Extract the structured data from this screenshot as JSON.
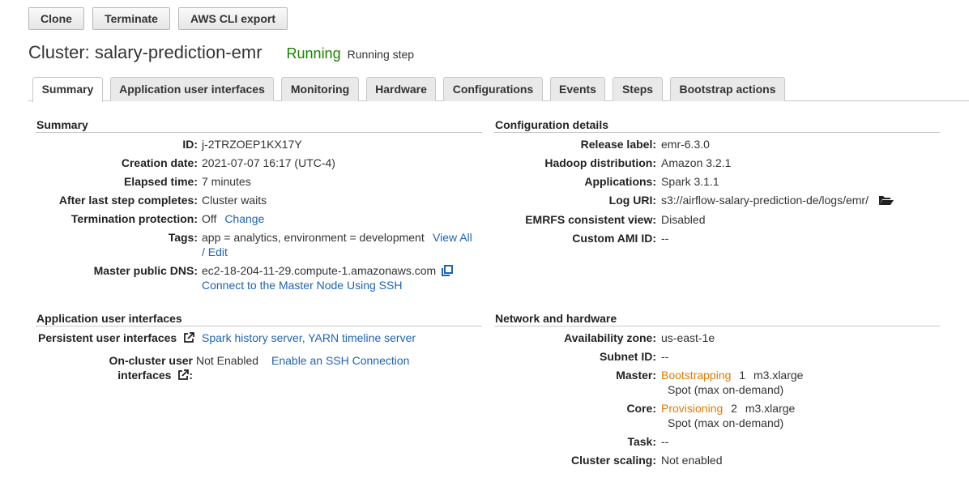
{
  "toolbar": {
    "clone_label": "Clone",
    "terminate_label": "Terminate",
    "cli_export_label": "AWS CLI export"
  },
  "header": {
    "title": "Cluster: salary-prediction-emr",
    "status": "Running",
    "status_detail": "Running step"
  },
  "tabs": [
    {
      "label": "Summary",
      "active": true
    },
    {
      "label": "Application user interfaces",
      "active": false
    },
    {
      "label": "Monitoring",
      "active": false
    },
    {
      "label": "Hardware",
      "active": false
    },
    {
      "label": "Configurations",
      "active": false
    },
    {
      "label": "Events",
      "active": false
    },
    {
      "label": "Steps",
      "active": false
    },
    {
      "label": "Bootstrap actions",
      "active": false
    }
  ],
  "summary": {
    "title": "Summary",
    "id_label": "ID:",
    "id_value": "j-2TRZOEP1KX17Y",
    "creation_label": "Creation date:",
    "creation_value": "2021-07-07 16:17 (UTC-4)",
    "elapsed_label": "Elapsed time:",
    "elapsed_value": "7 minutes",
    "after_step_label": "After last step completes:",
    "after_step_value": "Cluster waits",
    "termination_label": "Termination protection:",
    "termination_value": "Off",
    "termination_link": "Change",
    "tags_label": "Tags:",
    "tags_value": "app = analytics, environment = development",
    "tags_link_view": "View All",
    "tags_link_edit": "/ Edit",
    "dns_label": "Master public DNS:",
    "dns_value": "ec2-18-204-11-29.compute-1.amazonaws.com",
    "ssh_link": "Connect to the Master Node Using SSH"
  },
  "config": {
    "title": "Configuration details",
    "release_label": "Release label:",
    "release_value": "emr-6.3.0",
    "hadoop_label": "Hadoop distribution:",
    "hadoop_value": "Amazon 3.2.1",
    "apps_label": "Applications:",
    "apps_value": "Spark 3.1.1",
    "log_label": "Log URI:",
    "log_value": "s3://airflow-salary-prediction-de/logs/emr/",
    "emrfs_label": "EMRFS consistent view:",
    "emrfs_value": "Disabled",
    "ami_label": "Custom AMI ID:",
    "ami_value": "--"
  },
  "app_ui": {
    "title": "Application user interfaces",
    "persistent_label": "Persistent user interfaces",
    "persistent_value": "Spark history server, YARN timeline server",
    "oncluster_label_1": "On-cluster user",
    "oncluster_label_2": "interfaces",
    "oncluster_value": "Not Enabled",
    "oncluster_link": "Enable an SSH Connection"
  },
  "network": {
    "title": "Network and hardware",
    "az_label": "Availability zone:",
    "az_value": "us-east-1e",
    "subnet_label": "Subnet ID:",
    "subnet_value": "--",
    "master_label": "Master:",
    "master_status": "Bootstrapping",
    "master_count": "1",
    "master_type": "m3.xlarge",
    "master_market": "Spot (max on-demand)",
    "core_label": "Core:",
    "core_status": "Provisioning",
    "core_count": "2",
    "core_type": "m3.xlarge",
    "core_market": "Spot (max on-demand)",
    "task_label": "Task:",
    "task_value": "--",
    "scaling_label": "Cluster scaling:",
    "scaling_value": "Not enabled"
  },
  "colors": {
    "running": "#1d8102",
    "link": "#1e63b5",
    "orange_status": "#e07b00"
  },
  "icons": {
    "copy": "copy-icon",
    "folder": "folder-open-icon",
    "external": "external-link-icon"
  }
}
